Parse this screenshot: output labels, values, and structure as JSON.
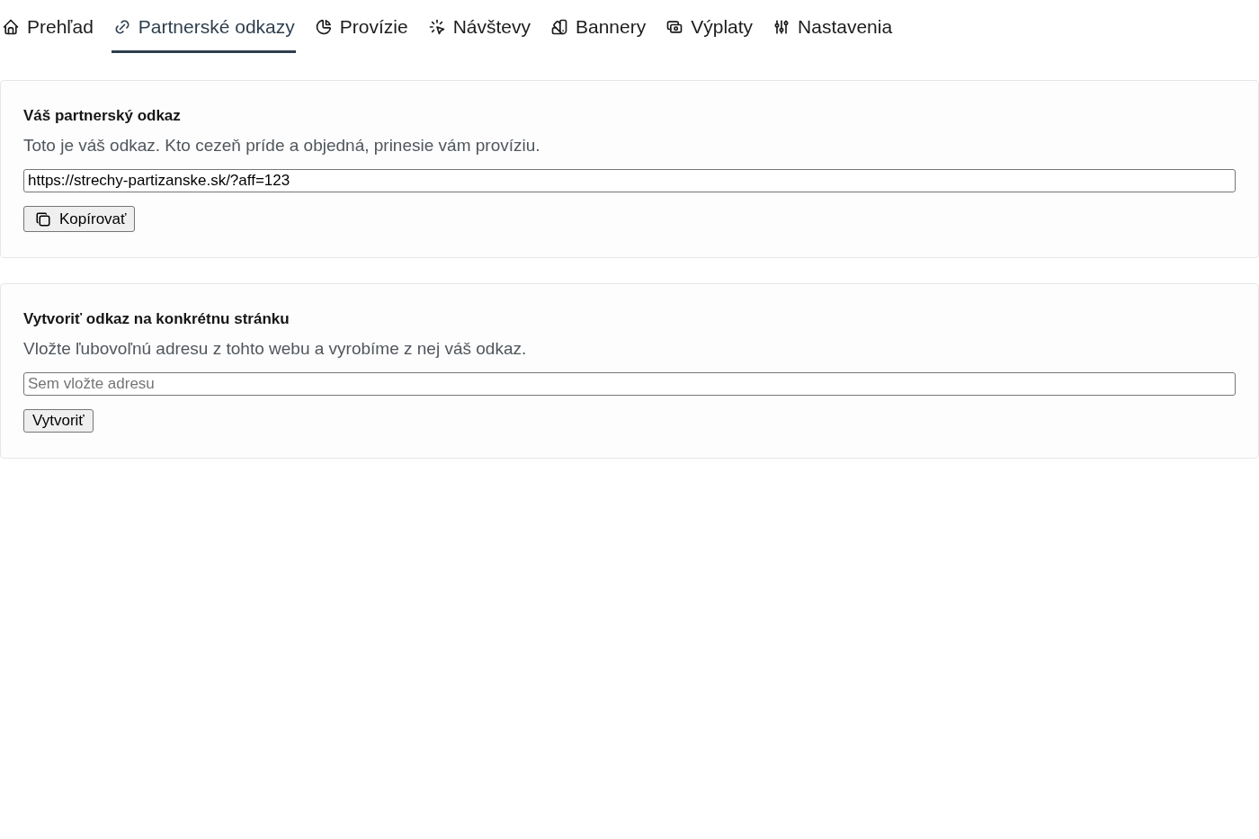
{
  "tabs": [
    {
      "label": "Prehľad",
      "selected": false
    },
    {
      "label": "Partnerské odkazy",
      "selected": true
    },
    {
      "label": "Provízie",
      "selected": false
    },
    {
      "label": "Návštevy",
      "selected": false
    },
    {
      "label": "Bannery",
      "selected": false
    },
    {
      "label": "Výplaty",
      "selected": false
    },
    {
      "label": "Nastavenia",
      "selected": false
    }
  ],
  "sections": [
    {
      "title": "Váš partnerský odkaz",
      "description": "Toto je váš odkaz. Kto cezeň príde a objedná, prinesie vám províziu.",
      "field": {
        "value": "https://strechy-partizanske.sk/?aff=123"
      },
      "button": {
        "label": "Kopírovať",
        "kind": "copy"
      }
    },
    {
      "title": "Vytvoriť odkaz na konkrétnu stránku",
      "description": "Vložte ľubovoľnú adresu z tohto webu a vyrobíme z nej váš odkaz.",
      "field": {
        "placeholder": "Sem vložte adresu"
      },
      "button": {
        "label": "Vytvoriť",
        "kind": "plain"
      }
    }
  ]
}
